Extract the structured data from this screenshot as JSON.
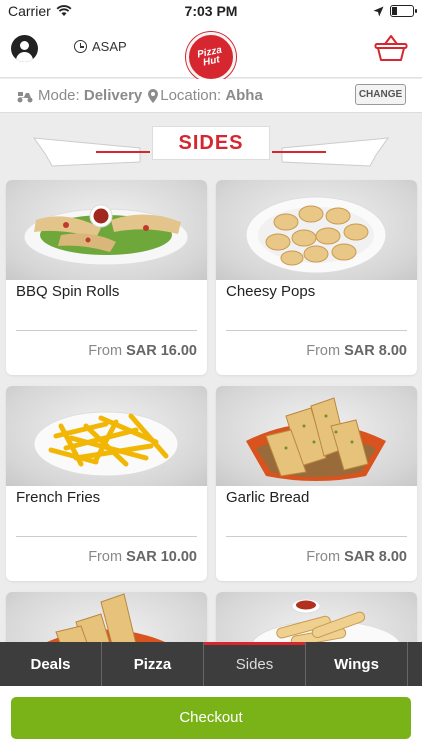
{
  "status_bar": {
    "carrier": "Carrier",
    "time": "7:03 PM"
  },
  "header": {
    "asap_label": "ASAP",
    "logo_text_line1": "Pizza",
    "logo_text_line2": "Hut"
  },
  "mode_bar": {
    "mode_label": "Mode:",
    "mode_value": "Delivery",
    "location_label": "Location:",
    "location_value": "Abha",
    "change_label": "CHANGE"
  },
  "section": {
    "title": "SIDES"
  },
  "items": [
    {
      "name": "BBQ Spin Rolls",
      "from": "From",
      "price": "SAR 16.00"
    },
    {
      "name": "Cheesy Pops",
      "from": "From",
      "price": "SAR 8.00"
    },
    {
      "name": "French Fries",
      "from": "From",
      "price": "SAR 10.00"
    },
    {
      "name": "Garlic Bread",
      "from": "From",
      "price": "SAR 8.00"
    }
  ],
  "tabs": [
    {
      "label": "Deals",
      "active": false
    },
    {
      "label": "Pizza",
      "active": false
    },
    {
      "label": "Sides",
      "active": true
    },
    {
      "label": "Wings",
      "active": false
    }
  ],
  "checkout": {
    "label": "Checkout"
  },
  "colors": {
    "brand_red": "#d62630",
    "checkout_green": "#7ab318",
    "tab_bar": "#3d3d3d"
  }
}
